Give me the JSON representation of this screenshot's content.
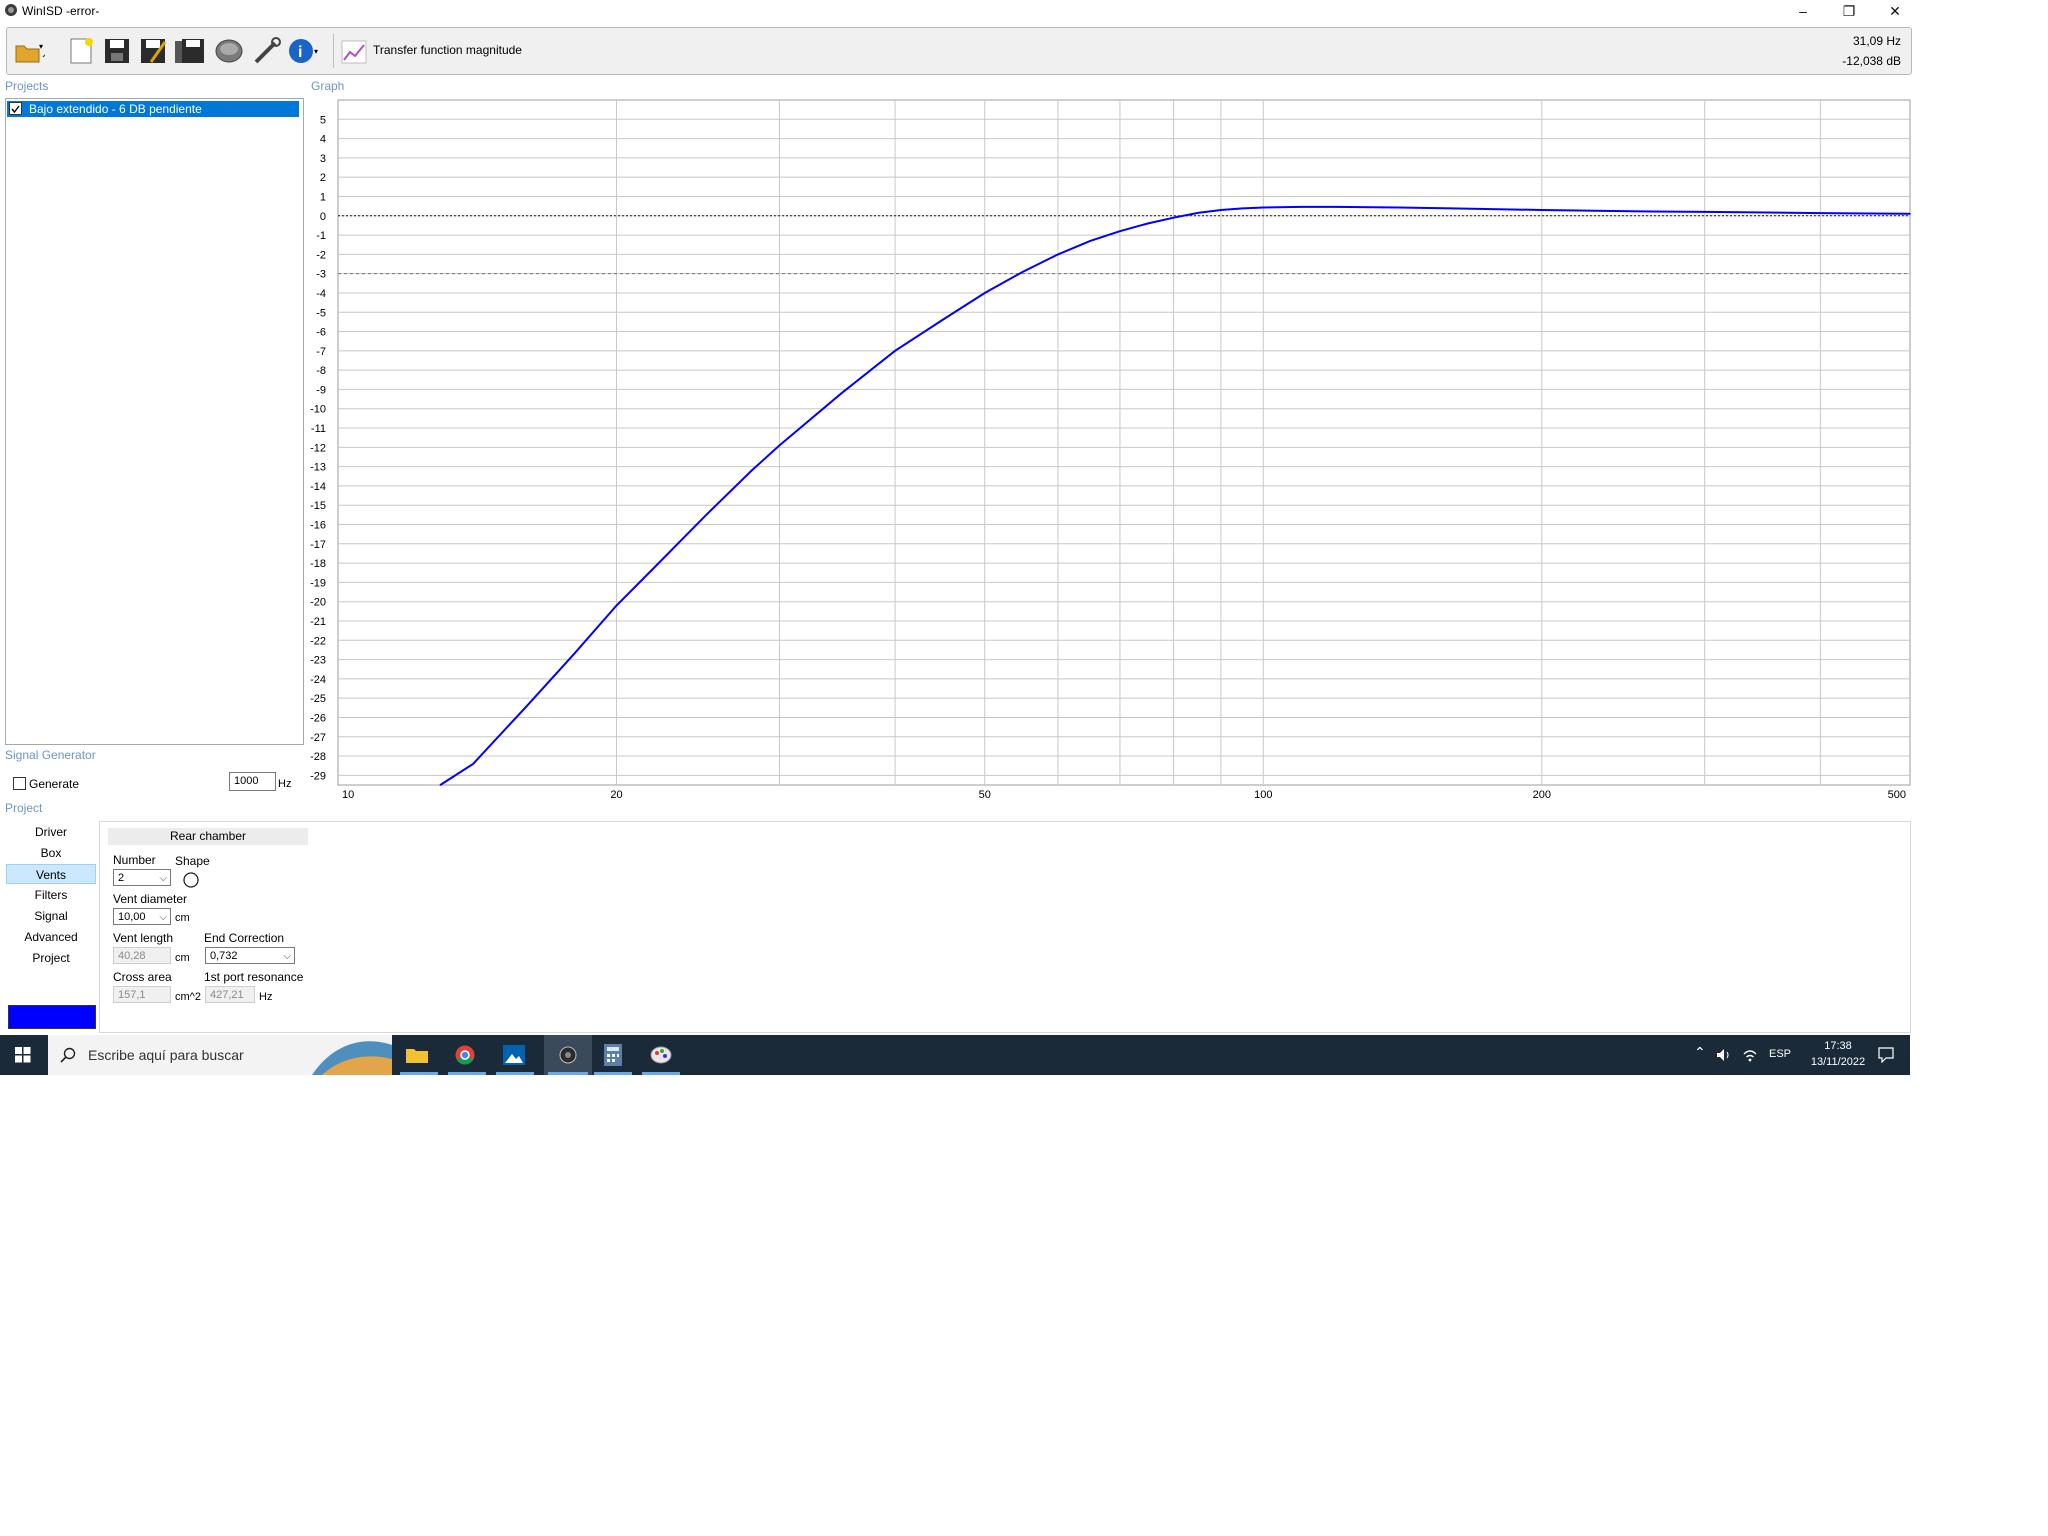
{
  "window": {
    "title": "WinISD -error-",
    "minimize": "–",
    "restore": "❐",
    "close": "✕"
  },
  "toolbar": {
    "graph_label": "Transfer function magnitude",
    "readout_freq": "31,09 Hz",
    "readout_db": "-12,038 dB",
    "icons": [
      "open-folder-icon",
      "new-file-icon",
      "save-icon",
      "save-as-icon",
      "save-all-icon",
      "driver-icon",
      "tools-icon",
      "info-icon",
      "graph-icon"
    ]
  },
  "projects": {
    "label": "Projects",
    "items": [
      {
        "name": "Bajo extendido - 6 DB pendiente",
        "checked": true
      }
    ]
  },
  "graph": {
    "label": "Graph"
  },
  "signal_generator": {
    "label": "Signal Generator",
    "generate_label": "Generate",
    "frequency_value": "1000",
    "frequency_unit": "Hz"
  },
  "project_section": {
    "label": "Project",
    "nav": [
      "Driver",
      "Box",
      "Vents",
      "Filters",
      "Signal",
      "Advanced",
      "Project"
    ],
    "selected_nav": "Vents",
    "color_swatch": "#0000ff"
  },
  "vents": {
    "tab": "Rear chamber",
    "number_label": "Number",
    "number_value": "2",
    "shape_label": "Shape",
    "diameter_label": "Vent diameter",
    "diameter_value": "10,00",
    "diameter_unit": "cm",
    "length_label": "Vent length",
    "length_value": "40,28",
    "length_unit": "cm",
    "end_correction_label": "End Correction",
    "end_correction_value": "0,732",
    "cross_area_label": "Cross area",
    "cross_area_value": "157,1",
    "cross_area_unit": "cm^2",
    "port_resonance_label": "1st port resonance",
    "port_resonance_value": "427,21",
    "port_resonance_unit": "Hz"
  },
  "taskbar": {
    "search_placeholder": "Escribe aquí para buscar",
    "language": "ESP",
    "time": "17:38",
    "date": "13/11/2022"
  },
  "chart_data": {
    "type": "line",
    "title": "",
    "xlabel": "",
    "ylabel": "",
    "x_scale": "log",
    "xlim": [
      10,
      500
    ],
    "ylim": [
      -29.5,
      6
    ],
    "x_ticks": [
      10,
      20,
      50,
      100,
      200,
      500
    ],
    "y_ticks": [
      5,
      4,
      3,
      2,
      1,
      0,
      -1,
      -2,
      -3,
      -4,
      -5,
      -6,
      -7,
      -8,
      -9,
      -10,
      -11,
      -12,
      -13,
      -14,
      -15,
      -16,
      -17,
      -18,
      -19,
      -20,
      -21,
      -22,
      -23,
      -24,
      -25,
      -26,
      -27,
      -28,
      -29
    ],
    "reference_lines": [
      0,
      -3
    ],
    "grid": true,
    "series": [
      {
        "color": "#0000ff",
        "x": [
          12.9,
          14,
          16,
          18,
          20,
          22,
          25,
          28,
          30,
          35,
          40,
          45,
          50,
          55,
          60,
          65,
          70,
          75,
          80,
          85,
          90,
          95,
          100,
          110,
          120,
          140,
          160,
          200,
          250,
          300,
          400,
          500
        ],
        "y": [
          -30,
          -28.4,
          -25.4,
          -22.7,
          -20.2,
          -18.2,
          -15.5,
          -13.2,
          -11.9,
          -9.2,
          -7.0,
          -5.4,
          -4.0,
          -2.9,
          -2.0,
          -1.3,
          -0.8,
          -0.4,
          -0.1,
          0.15,
          0.3,
          0.38,
          0.43,
          0.46,
          0.46,
          0.43,
          0.38,
          0.3,
          0.23,
          0.2,
          0.14,
          0.1
        ]
      }
    ]
  }
}
